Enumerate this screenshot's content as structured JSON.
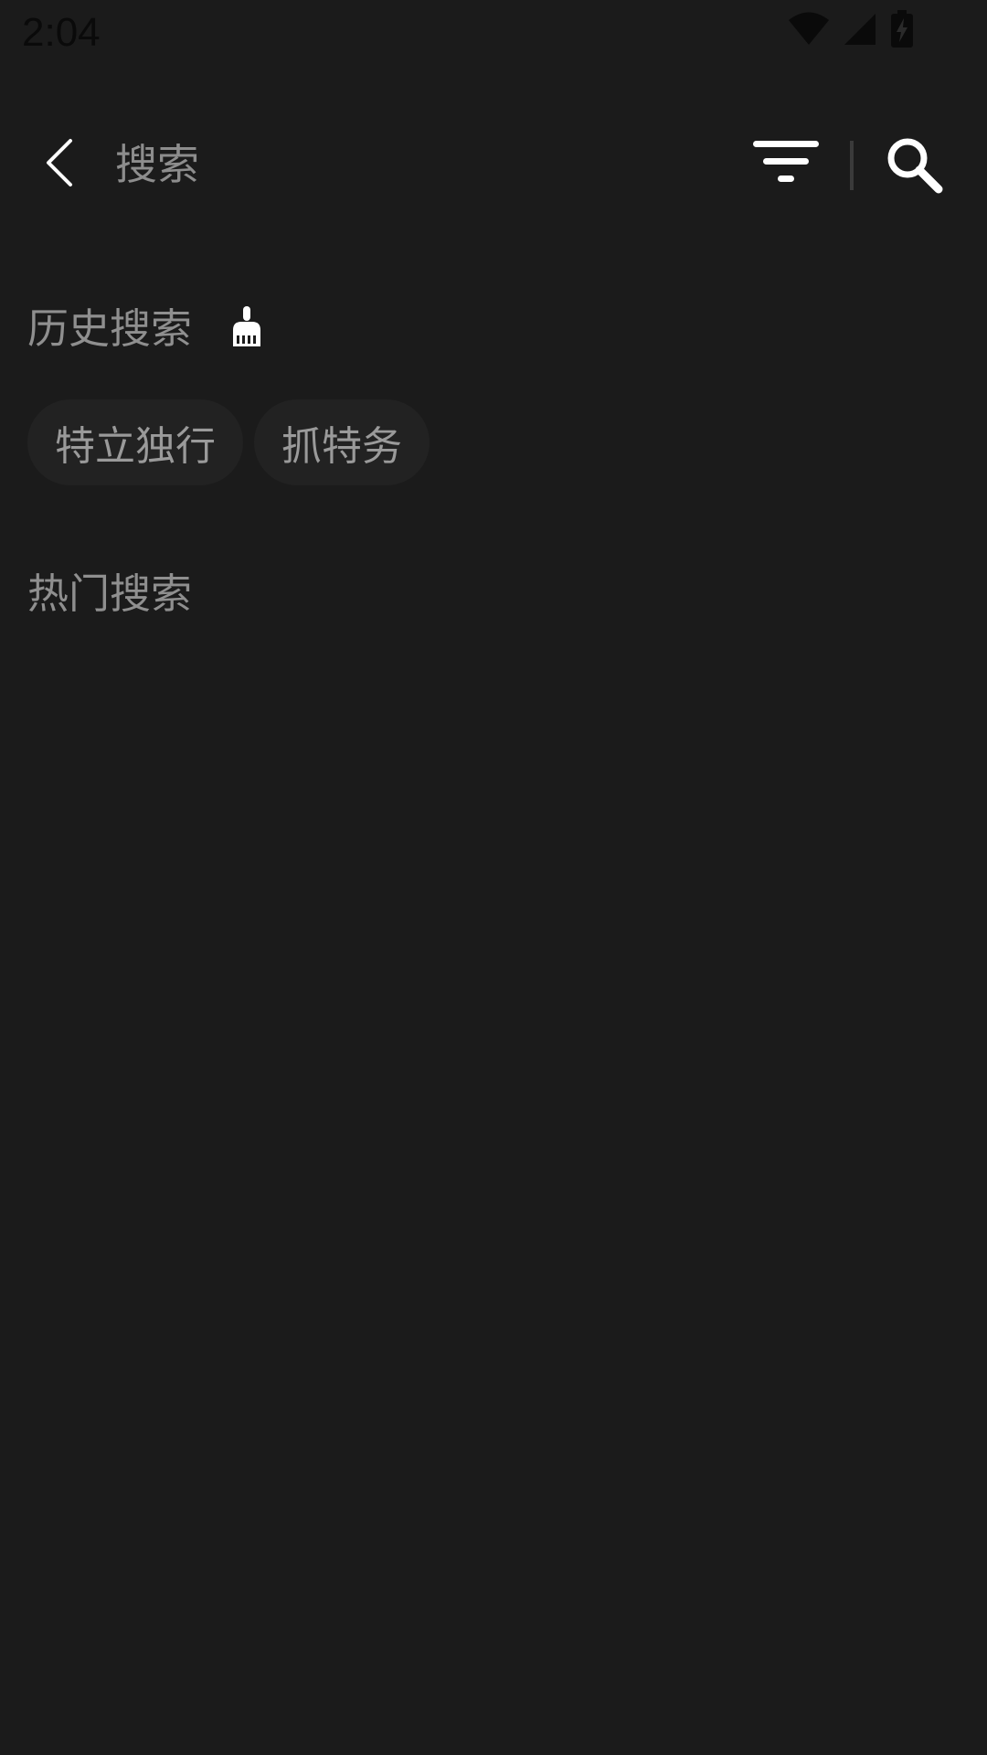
{
  "status_bar": {
    "time": "2:04",
    "icons": [
      "wifi-icon",
      "cellular-signal-icon",
      "battery-charging-icon"
    ]
  },
  "header": {
    "back_icon": "chevron-left-icon",
    "search_placeholder": "搜索",
    "search_value": "",
    "filter_icon": "filter-icon",
    "search_icon": "search-icon"
  },
  "history": {
    "title": "历史搜索",
    "clear_icon": "broom-icon",
    "tags": [
      "特立独行",
      "抓特务"
    ]
  },
  "hot": {
    "title": "热门搜索"
  },
  "colors": {
    "background": "#1b1b1b",
    "text_secondary": "#8f8f8f",
    "tag_background": "#222222",
    "icon": "#ffffff"
  }
}
